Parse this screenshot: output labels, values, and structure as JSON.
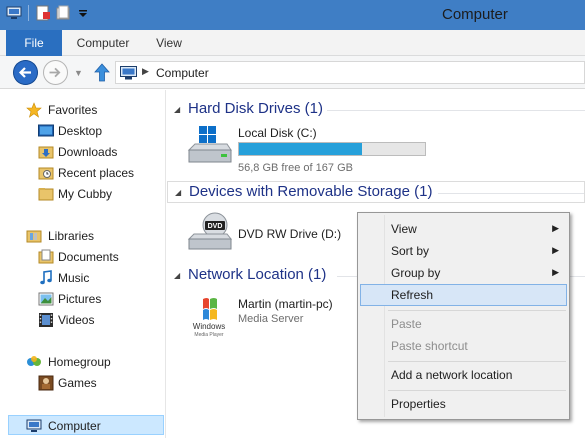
{
  "window": {
    "title": "Computer"
  },
  "quick_access": {
    "icons": [
      "computer-icon",
      "properties-icon",
      "new-folder-icon",
      "customize-dropdown-icon"
    ]
  },
  "ribbon": {
    "tabs": [
      {
        "label": "File"
      },
      {
        "label": "Computer"
      },
      {
        "label": "View"
      }
    ]
  },
  "address_bar": {
    "path": "Computer",
    "separator": "▶"
  },
  "nav_pane": {
    "favorites": {
      "label": "Favorites",
      "items": [
        "Desktop",
        "Downloads",
        "Recent places",
        "My Cubby"
      ]
    },
    "libraries": {
      "label": "Libraries",
      "items": [
        "Documents",
        "Music",
        "Pictures",
        "Videos"
      ]
    },
    "homegroup": {
      "label": "Homegroup",
      "items": [
        "Games"
      ]
    },
    "computer": {
      "label": "Computer"
    }
  },
  "content": {
    "groups": [
      {
        "title": "Hard Disk Drives (1)",
        "items": [
          {
            "name": "Local Disk (C:)",
            "subtitle": "56,8 GB free of 167 GB",
            "used_fraction": 0.66
          }
        ]
      },
      {
        "title": "Devices with Removable Storage (1)",
        "items": [
          {
            "name": "DVD RW Drive (D:)"
          }
        ]
      },
      {
        "title": "Network Location (1)",
        "items": [
          {
            "name": "Martin (martin-pc)",
            "subtitle": "Media Server"
          }
        ]
      }
    ]
  },
  "context_menu": {
    "items": [
      {
        "label": "View",
        "submenu": "▶"
      },
      {
        "label": "Sort by",
        "submenu": "▶"
      },
      {
        "label": "Group by",
        "submenu": "▶"
      },
      {
        "label": "Refresh"
      },
      {
        "label": "Paste"
      },
      {
        "label": "Paste shortcut"
      },
      {
        "label": "Add a network location"
      },
      {
        "label": "Properties"
      }
    ]
  },
  "colors": {
    "titlebar": "#3f7ec5",
    "file_tab": "#2a6fc0",
    "group_title": "#1e3287",
    "drive_bar": "#26a0da",
    "selection": "#cce8ff"
  }
}
